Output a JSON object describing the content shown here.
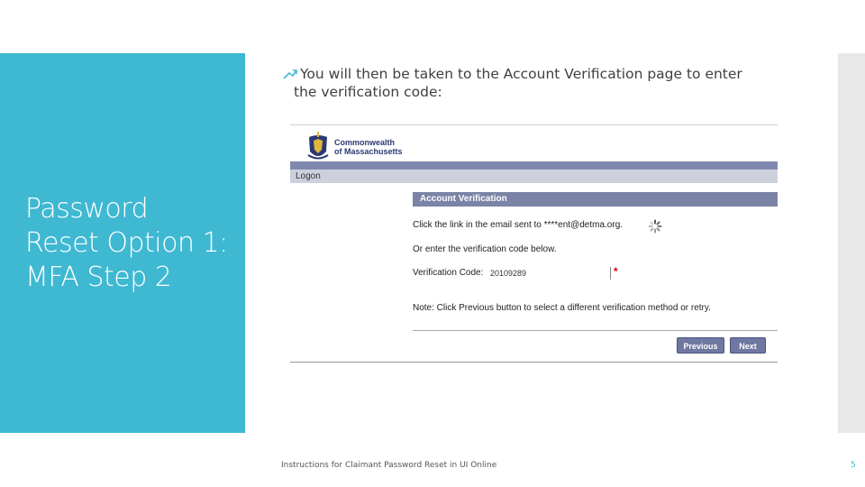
{
  "slide": {
    "title_line1": "Password",
    "title_line2": "Reset Option 1:",
    "title_line3": "MFA Step 2",
    "bullet_line1": "You will then be taken to the Account Verification page to enter",
    "bullet_line2": "the verification code:",
    "footer": "Instructions for Claimant Password Reset in UI Online",
    "page_number": "5",
    "accent_color": "#3fb8d2"
  },
  "screenshot": {
    "org_line1": "Commonwealth",
    "org_line2": "of Massachusetts",
    "nav_label": "Logon",
    "panel_title": "Account Verification",
    "email_msg": "Click the link in the email sent to ****ent@detma.org.",
    "alt_msg": "Or enter the verification code below.",
    "code_label": "Verification Code:",
    "code_value": "20109289",
    "required_marker": "*",
    "note": "Note: Click Previous button to select a different verification method or retry.",
    "previous_label": "Previous",
    "next_label": "Next",
    "header_color": "#7b83a6"
  }
}
